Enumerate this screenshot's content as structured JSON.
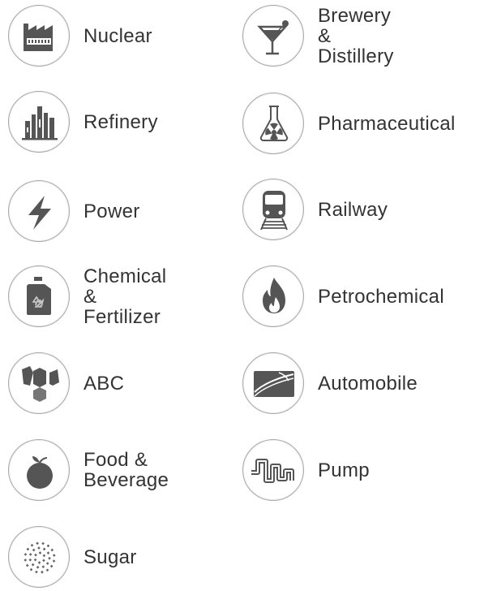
{
  "industries": [
    {
      "label": "Nuclear",
      "icon": "factory-icon"
    },
    {
      "label": "Brewery &",
      "label2": "Distillery",
      "icon": "cocktail-glass-icon"
    },
    {
      "label": "Refinery",
      "icon": "refinery-icon"
    },
    {
      "label": "Pharmaceutical",
      "icon": "flask-icon"
    },
    {
      "label": "Power",
      "icon": "lightning-icon"
    },
    {
      "label": "Railway",
      "icon": "train-icon"
    },
    {
      "label": "Chemical &",
      "label2": "Fertilizer",
      "icon": "chemical-canister-icon"
    },
    {
      "label": "Petrochemical",
      "icon": "flame-icon"
    },
    {
      "label": "ABC",
      "icon": "hexagon-blocks-icon"
    },
    {
      "label": "Automobile",
      "icon": "automobile-icon"
    },
    {
      "label": "Food &",
      "label2": "Beverage",
      "icon": "fruit-icon"
    },
    {
      "label": "Pump",
      "icon": "pump-pipe-icon"
    },
    {
      "label": "Sugar",
      "icon": "sugar-crystals-icon"
    }
  ],
  "colors": {
    "icon": "#555555",
    "text": "#333333",
    "ring": "#a8a8a8"
  }
}
